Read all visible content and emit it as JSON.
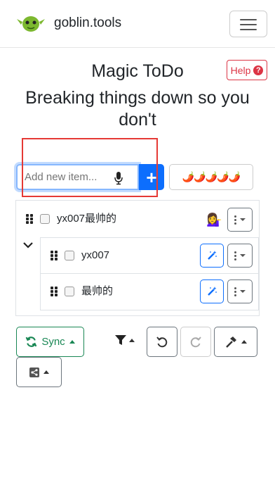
{
  "nav": {
    "brand": "goblin.tools",
    "logo_icon": "goblin-face-icon",
    "menu_icon": "hamburger-icon"
  },
  "page": {
    "title": "Magic ToDo",
    "subtitle": "Breaking things down so you don't",
    "help_label": "Help",
    "help_icon": "question-circle-icon"
  },
  "add": {
    "placeholder": "Add new item...",
    "value": "",
    "mic_icon": "microphone-icon",
    "add_icon": "plus-icon",
    "spiciness": "🌶️🌶️🌶️🌶️🌶️"
  },
  "tasks": [
    {
      "text": "yx007最帅的",
      "checked": false,
      "emoji": "💁‍♀️",
      "expanded": true,
      "subtasks": [
        {
          "text": "yx007",
          "checked": false
        },
        {
          "text": "最帅的",
          "checked": false
        }
      ]
    }
  ],
  "toolbar": {
    "sync_label": "Sync",
    "sync_icon": "sync-icon",
    "filter_icon": "filter-icon",
    "undo_icon": "undo-icon",
    "redo_icon": "redo-icon",
    "tools_icon": "hammer-icon",
    "share_icon": "share-icon"
  },
  "colors": {
    "primary": "#0d6efd",
    "success": "#198754",
    "danger": "#dc3545",
    "annotation_box": "#e53935"
  }
}
